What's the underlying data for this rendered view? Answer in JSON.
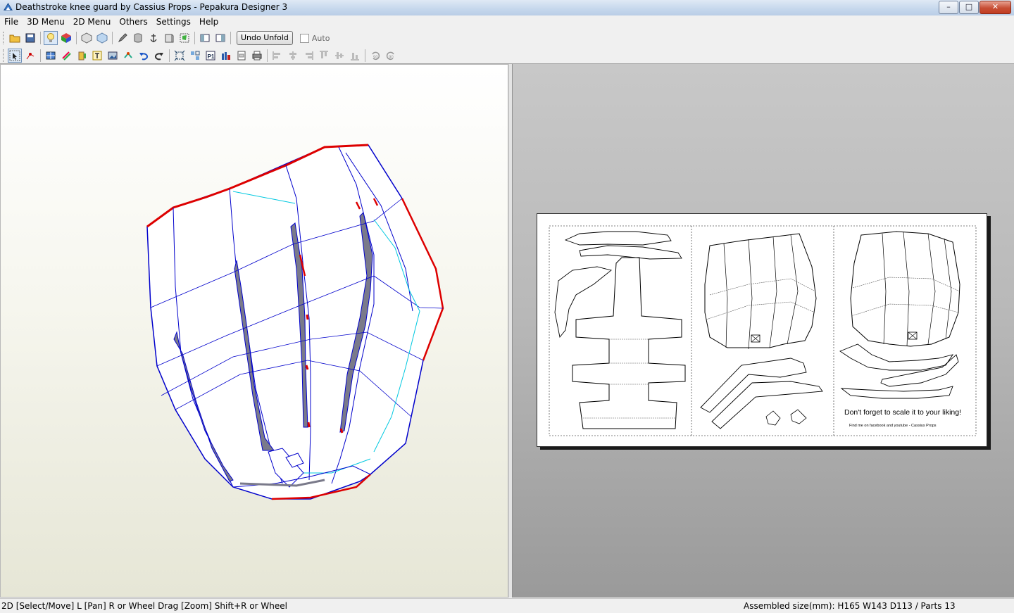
{
  "window": {
    "title": "Deathstroke knee guard by Cassius Props - Pepakura Designer 3"
  },
  "menu": [
    "File",
    "3D Menu",
    "2D Menu",
    "Others",
    "Settings",
    "Help"
  ],
  "toolbar1": {
    "undo_unfold_label": "Undo Unfold",
    "auto_label": "Auto",
    "auto_checked": false
  },
  "paper": {
    "note": "Don't forget to scale it to your liking!",
    "credit": "Find me on facebook and youtube - Cassius Props"
  },
  "status": {
    "left": "2D [Select/Move] L [Pan] R or Wheel Drag [Zoom] Shift+R or Wheel",
    "right": "Assembled size(mm): H165 W143 D113 / Parts 13"
  },
  "colors": {
    "cut_edge": "#0000cc",
    "mountain_fold": "#cc0000",
    "valley_fold": "#00c8e0",
    "paper_bg": "#9a9a9a"
  }
}
